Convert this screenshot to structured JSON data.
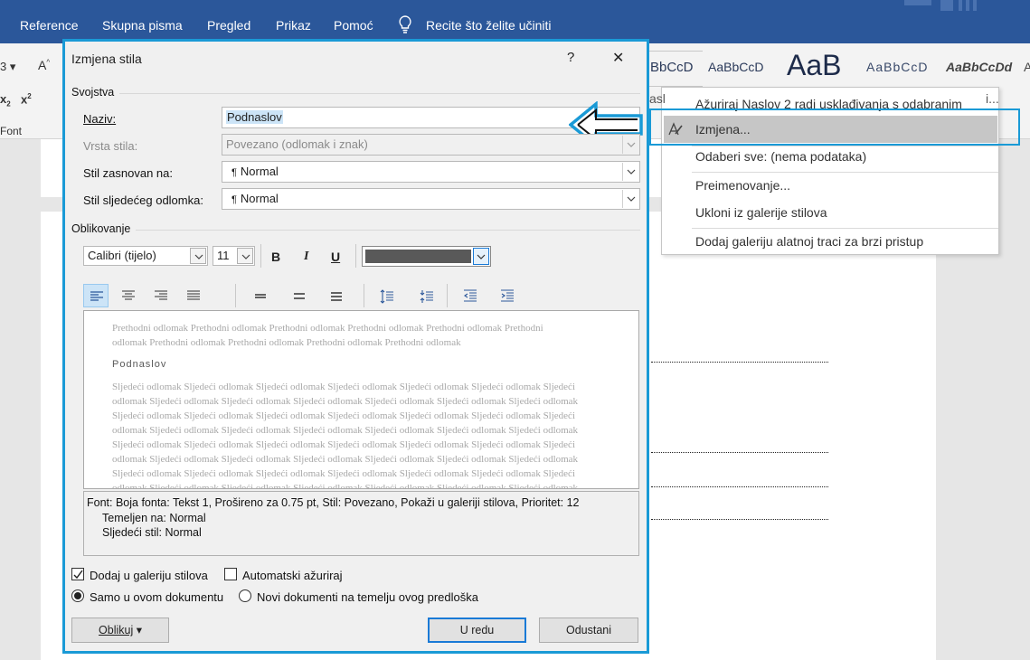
{
  "ribbon": {
    "menu": [
      "Reference",
      "Skupna pisma",
      "Pregled",
      "Prikaz",
      "Pomoć"
    ],
    "tell_me": "Recite što želite učiniti",
    "font_group_label": "Font",
    "style_previews": [
      "BbCcD",
      "AaBbCcD",
      "AaB",
      "AaBbCcD",
      "AaBbCcDd",
      "A"
    ]
  },
  "context_menu": {
    "items": [
      "Ažuriraj Naslov 2 radi usklađivanja s odabranim",
      "Izmjena...",
      "Odaberi sve: (nema podataka)",
      "Preimenovanje...",
      "Ukloni iz galerije stilova",
      "Dodaj galeriju alatnoj traci za brzi pristup"
    ],
    "highlighted_index": 1,
    "overflow_left": "asl",
    "overflow_right": "i..."
  },
  "dialog": {
    "title": "Izmjena stila",
    "help": "?",
    "close": "✕",
    "properties_group": "Svojstva",
    "name_label": "Naziv:",
    "name_value": "Podnaslov",
    "style_type_label": "Vrsta stila:",
    "style_type_value": "Povezano (odlomak i znak)",
    "based_on_label": "Stil zasnovan na:",
    "based_on_value": "Normal",
    "next_style_label": "Stil sljedećeg odlomka:",
    "next_style_value": "Normal",
    "formatting_group": "Oblikovanje",
    "font_name": "Calibri (tijelo)",
    "font_size": "11",
    "bold": "B",
    "italic": "I",
    "underline": "U",
    "font_color": "#595959",
    "preview": {
      "previous": "Prethodni odlomak Prethodni odlomak Prethodni odlomak Prethodni odlomak Prethodni odlomak Prethodni odlomak Prethodni odlomak Prethodni odlomak Prethodni odlomak Prethodni odlomak",
      "sample": "Podnaslov",
      "following": "Sljedeći odlomak Sljedeći odlomak Sljedeći odlomak Sljedeći odlomak Sljedeći odlomak Sljedeći odlomak Sljedeći odlomak Sljedeći odlomak Sljedeći odlomak Sljedeći odlomak Sljedeći odlomak Sljedeći odlomak Sljedeći odlomak Sljedeći odlomak Sljedeći odlomak Sljedeći odlomak Sljedeći odlomak Sljedeći odlomak Sljedeći odlomak Sljedeći odlomak Sljedeći odlomak Sljedeći odlomak Sljedeći odlomak Sljedeći odlomak Sljedeći odlomak Sljedeći odlomak Sljedeći odlomak Sljedeći odlomak Sljedeći odlomak Sljedeći odlomak Sljedeći odlomak Sljedeći odlomak Sljedeći odlomak Sljedeći odlomak Sljedeći odlomak Sljedeći odlomak Sljedeći odlomak Sljedeći odlomak Sljedeći odlomak Sljedeći odlomak Sljedeći odlomak Sljedeći odlomak Sljedeći odlomak Sljedeći odlomak Sljedeći odlomak Sljedeći odlomak Sljedeći odlomak Sljedeći odlomak Sljedeći odlomak Sljedeći odlomak Sljedeći odlomak Sljedeći odlomak Sljedeći odlomak Sljedeći odlomak Sljedeći odlomak Sljedeći odlomak Sljedeći odlomak"
    },
    "description_line1": "Font: Boja fonta: Tekst 1, Prošireno za  0.75 pt, Stil: Povezano, Pokaži u galeriji stilova, Prioritet: 12",
    "description_line2": "Temeljen na: Normal",
    "description_line3": "Sljedeći stil: Normal",
    "add_to_gallery": "Dodaj u galeriju stilova",
    "auto_update": "Automatski ažuriraj",
    "only_this_doc": "Samo u ovom dokumentu",
    "new_docs": "Novi dokumenti na temelju ovog predloška",
    "format_button": "Oblikuj",
    "ok_button": "U redu",
    "cancel_button": "Odustani"
  },
  "colors": {
    "accent": "#1a9ad6",
    "ribbon_bar": "#2b579a"
  }
}
